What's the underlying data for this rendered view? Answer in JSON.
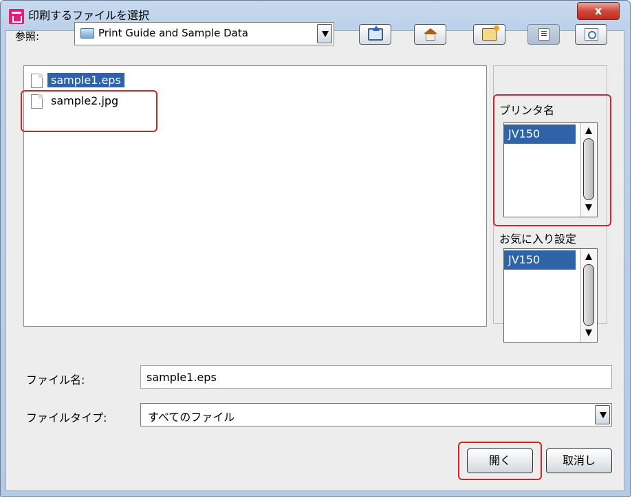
{
  "window": {
    "title": "印刷するファイルを選択",
    "close_glyph": "x"
  },
  "look_in": {
    "label": "参照:",
    "value": "Print Guide and Sample Data"
  },
  "toolbar": [
    "up-one-level",
    "home",
    "create-new-folder",
    "list-view",
    "details-view"
  ],
  "files": [
    {
      "name": "sample1.eps",
      "selected": true
    },
    {
      "name": "sample2.jpg",
      "selected": false
    }
  ],
  "printer": {
    "label": "プリンタ名",
    "items": [
      "JV150"
    ]
  },
  "favorites": {
    "label": "お気に入り設定",
    "items": [
      "JV150"
    ]
  },
  "file_name": {
    "label": "ファイル名:",
    "value": "sample1.eps"
  },
  "file_type": {
    "label": "ファイルタイプ:",
    "value": "すべてのファイル"
  },
  "buttons": {
    "open": "開く",
    "cancel": "取消し"
  },
  "colors": {
    "selection": "#2e64a7",
    "highlight": "#e02020",
    "title_gradient": "#c7d9ee"
  }
}
